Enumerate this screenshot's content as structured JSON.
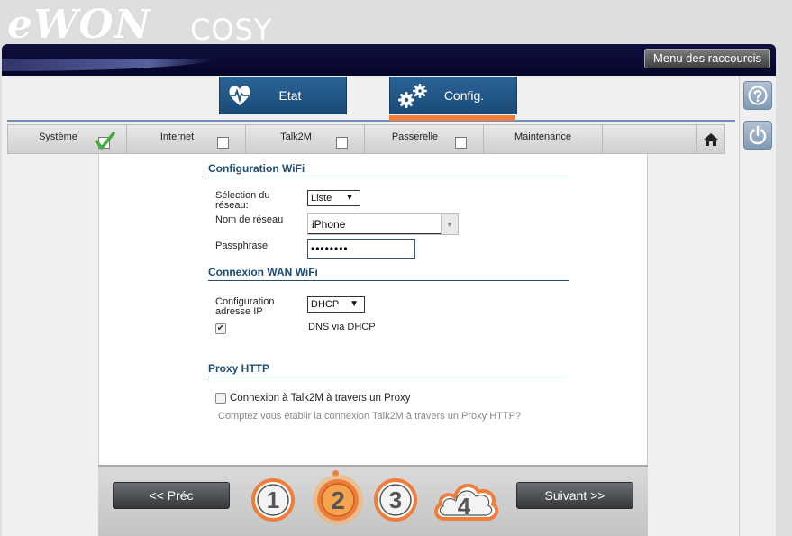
{
  "brand": {
    "logo": "eWON",
    "product": "COSY"
  },
  "header": {
    "shortcuts_label": "Menu des raccourcis"
  },
  "tabs": [
    {
      "label": "Etat",
      "icon": "heart-pulse-icon"
    },
    {
      "label": "Config.",
      "icon": "gears-icon"
    }
  ],
  "subnav": [
    {
      "label": "Système",
      "checked": true
    },
    {
      "label": "Internet",
      "checked": false
    },
    {
      "label": "Talk2M",
      "checked": false
    },
    {
      "label": "Passerelle",
      "checked": false
    },
    {
      "label": "Maintenance"
    }
  ],
  "wifi": {
    "title": "Configuration WiFi",
    "network_selection_label": "Sélection du réseau:",
    "network_selection_value": "Liste",
    "network_name_label": "Nom de réseau",
    "network_name_value": "iPhone",
    "passphrase_label": "Passphrase",
    "passphrase_value": "••••••••"
  },
  "wan": {
    "title": "Connexion WAN WiFi",
    "ip_config_label": "Configuration adresse IP",
    "ip_config_value": "DHCP",
    "dns_checked": true,
    "dns_label": "DNS via DHCP"
  },
  "proxy": {
    "title": "Proxy HTTP",
    "checkbox_label": "Connexion à Talk2M à travers un Proxy",
    "checked": false,
    "hint": "Comptez vous établir la connexion Talk2M à travers un Proxy HTTP?"
  },
  "wizard": {
    "prev_label": "<< Préc",
    "next_label": "Suivant >>",
    "steps": [
      "1",
      "2",
      "3",
      "4"
    ],
    "current_step": 2
  },
  "colors": {
    "accent": "#f07d3a",
    "tab_blue": "#1f5482",
    "section_title": "#1f4c73",
    "banner": "#0a0a33"
  }
}
